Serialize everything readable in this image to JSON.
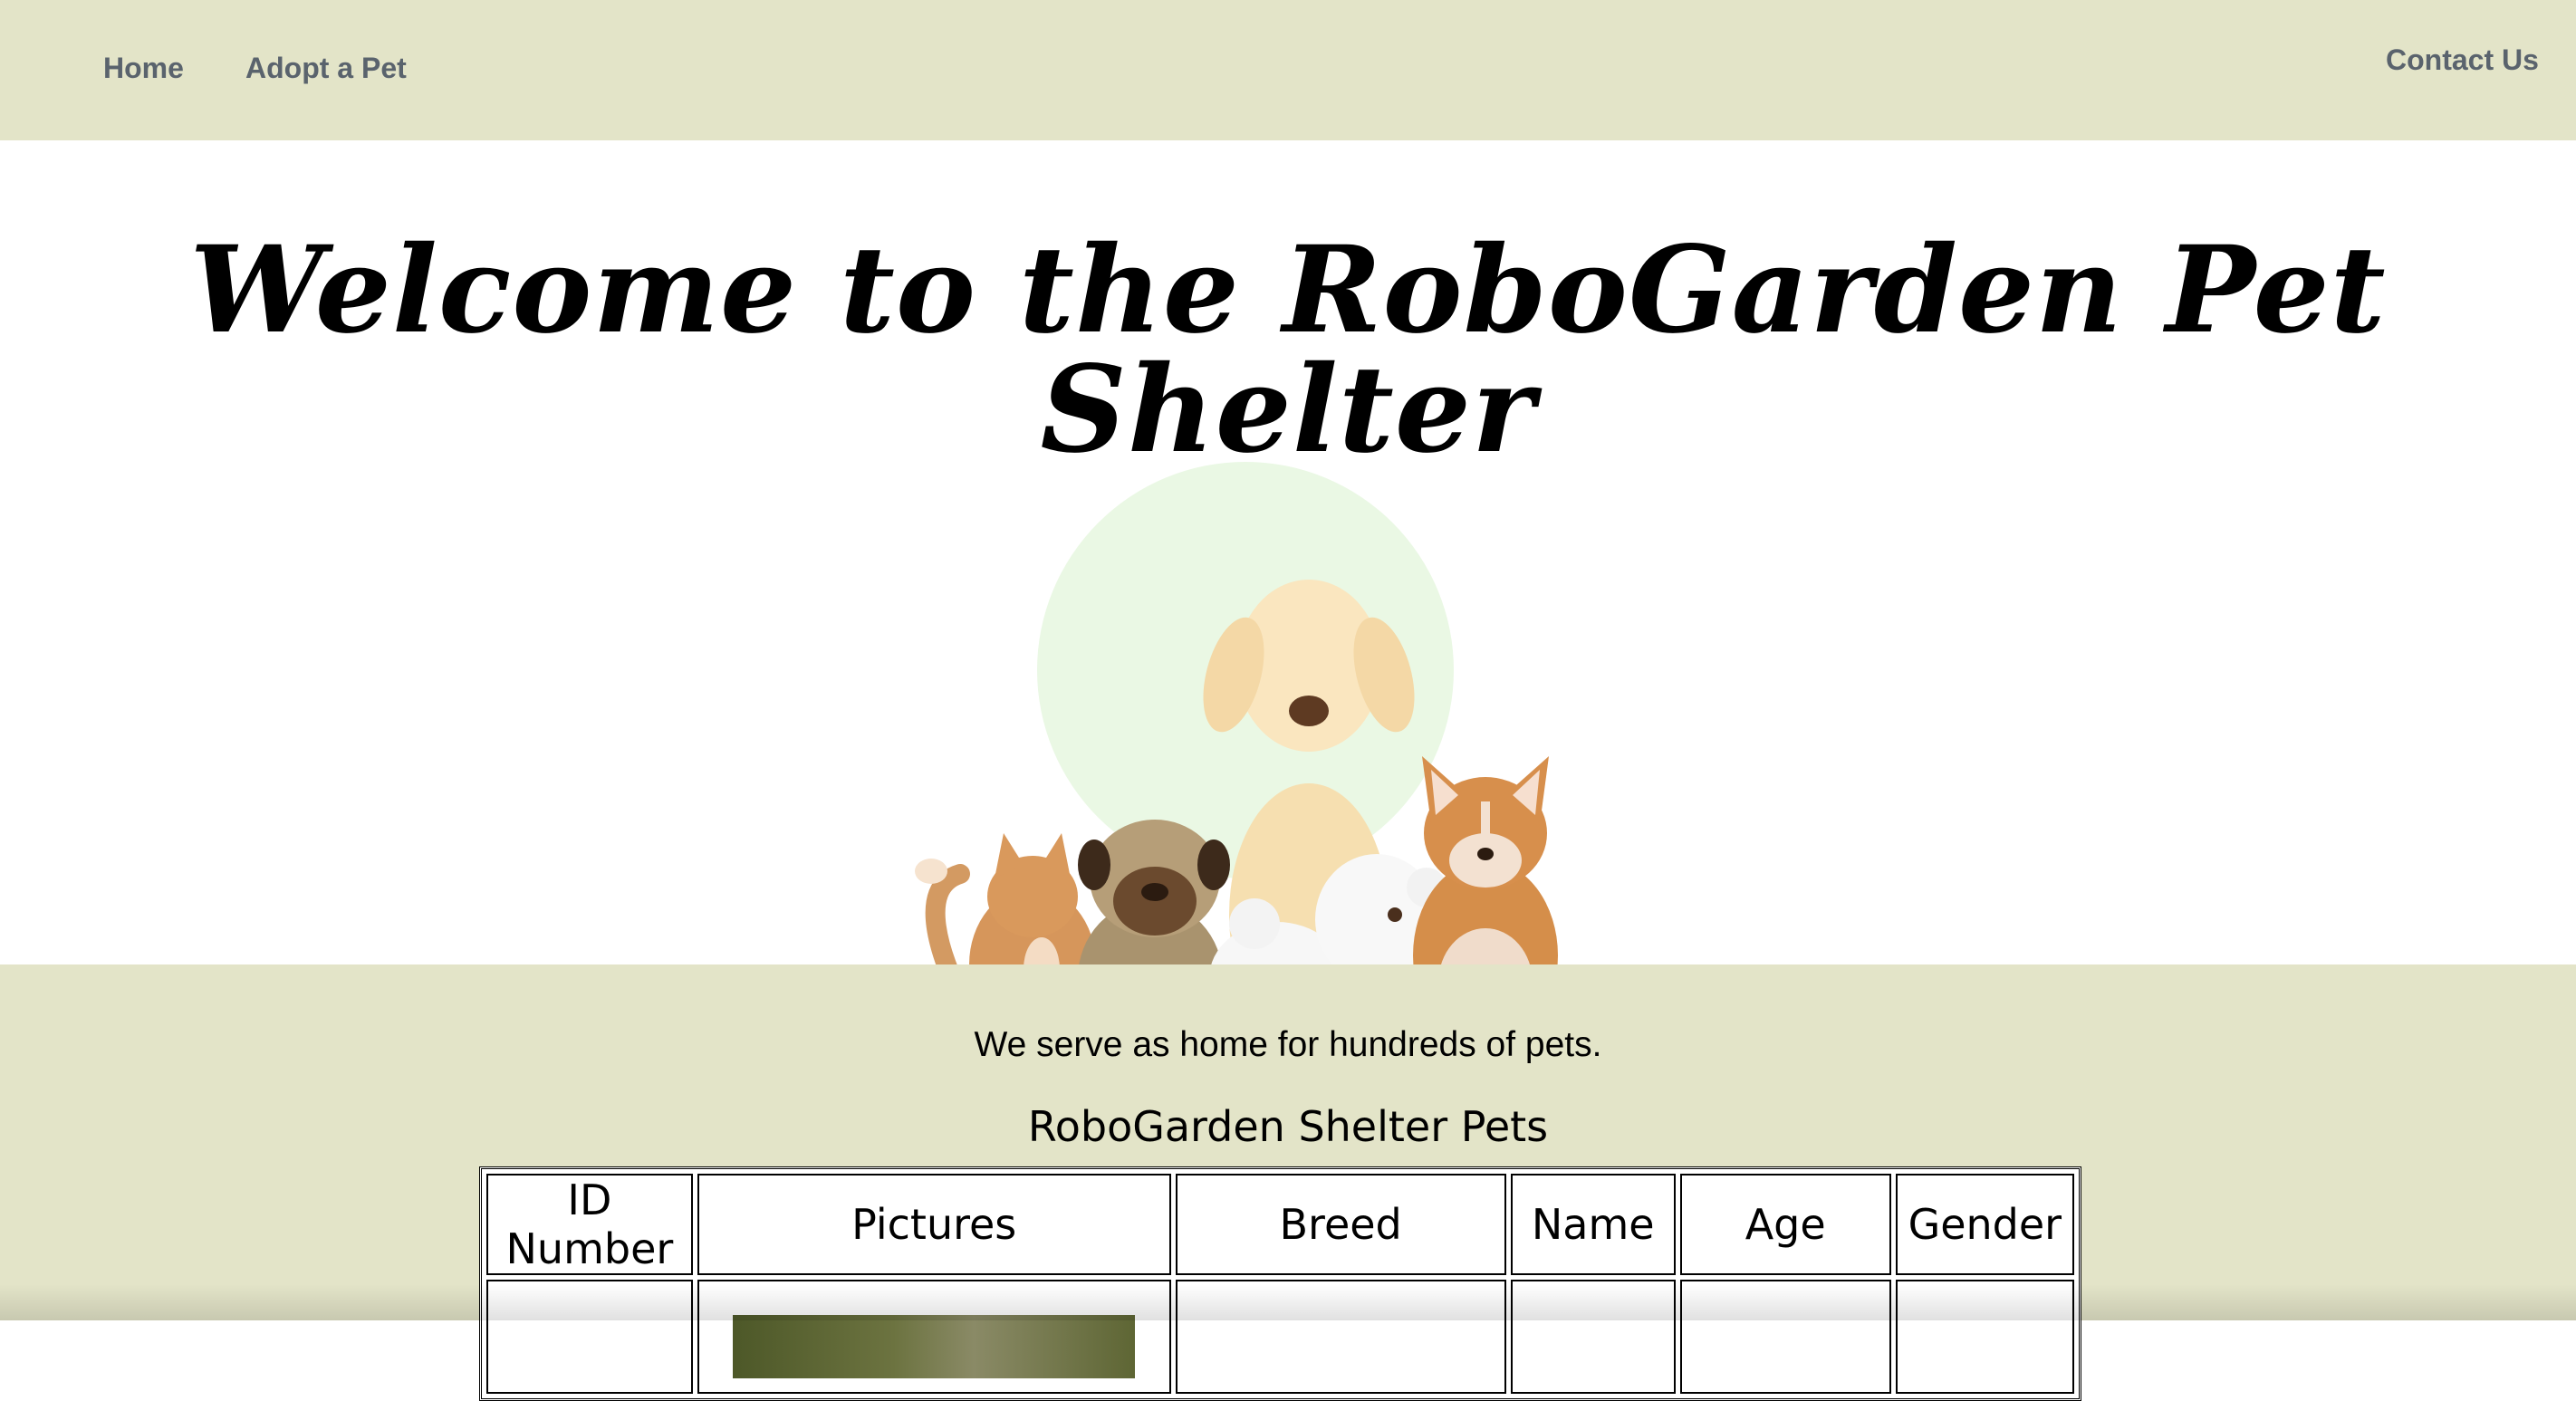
{
  "nav": {
    "home": "Home",
    "adopt": "Adopt a Pet",
    "contact": "Contact Us"
  },
  "hero": {
    "title": "Welcome to the RoboGarden Pet Shelter"
  },
  "content": {
    "tagline": "We serve as home for hundreds of pets.",
    "table_caption": "RoboGarden Shelter Pets",
    "columns": [
      "ID Number",
      "Pictures",
      "Breed",
      "Name",
      "Age",
      "Gender"
    ]
  },
  "colors": {
    "nav_bg": "#e3e4c8",
    "nav_text": "#5a636d",
    "hero_bg": "#ffffff",
    "accent_circle": "#eaf8e4"
  }
}
